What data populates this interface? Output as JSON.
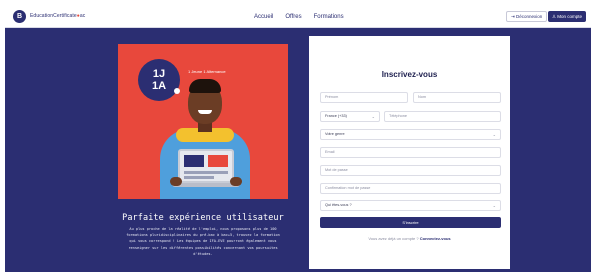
{
  "header": {
    "logo_text": "B",
    "brand_name": "EducationCertificate",
    "brand_suffix": "dot",
    "links": [
      "Accueil",
      "Offres",
      "Formations"
    ],
    "logout_label": "⇥ Déconnexion",
    "account_label": "♙ Mon compte"
  },
  "promo": {
    "badge": "1J\n1A",
    "tagline": "1 Jeune 1 Alternance",
    "title": "Parfaite expérience utilisateur",
    "text": "Au plus proche de la réalité de l'emploi, nous proposons plus de 100 formations pluridisciplinaires du pré-bac à bac+5, trouvez la formation qui vous correspond ! Les équipes de IFA-EVE pourront également vous renseigner sur les différentes possibilités concernant vos poursuites d'études."
  },
  "form": {
    "title": "Inscrivez-vous",
    "firstname_placeholder": "Prénom",
    "lastname_placeholder": "Nom",
    "country_code": "France (+33)",
    "phone_placeholder": "Téléphone",
    "gender_value": "Votre genre",
    "email_placeholder": "Email",
    "password_placeholder": "Mot de passe",
    "confirm_placeholder": "Confirmation mot de passe",
    "role_value": "Qui êtes-vous ?",
    "submit_label": "S'inscrire",
    "login_prompt": "Vous avez déjà un compte ?",
    "login_link": "Connectez-vous"
  },
  "colors": {
    "brand_navy": "#2b2e72",
    "accent_red": "#e8483c"
  }
}
